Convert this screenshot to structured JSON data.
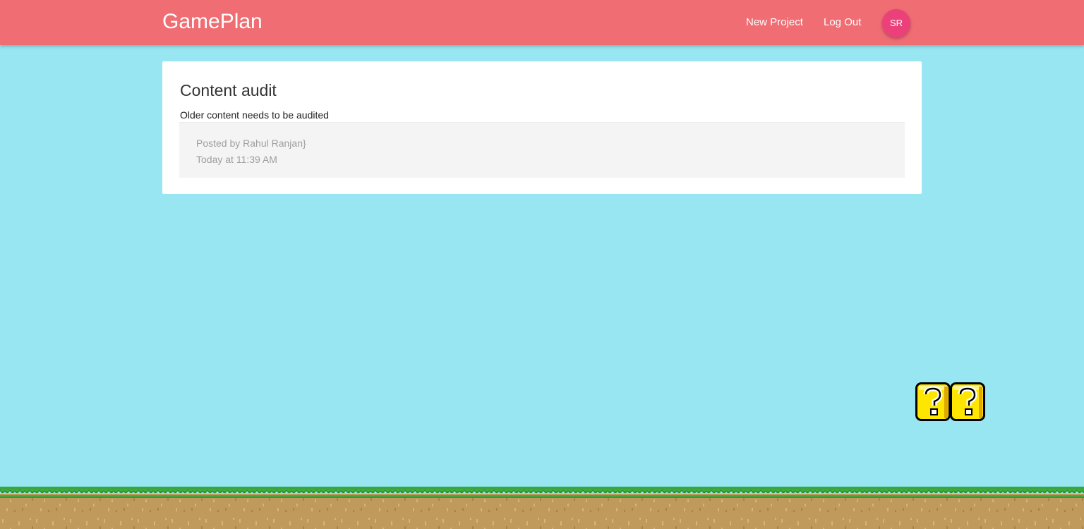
{
  "header": {
    "brand": "GamePlan",
    "nav": {
      "new_project": "New Project",
      "log_out": "Log Out"
    },
    "avatar_initials": "SR"
  },
  "card": {
    "title": "Content audit",
    "description": "Older content needs to be audited",
    "meta": {
      "author": "Posted by Rahul Ranjan}",
      "time": "Today at 11:39 AM"
    }
  },
  "decor": {
    "question_blocks": [
      "question-block-icon",
      "question-block-icon"
    ],
    "ground": "pixel-grass-ground"
  },
  "colors": {
    "navbar": "#f06d73",
    "background": "#97e6f2",
    "avatar": "#ec407a",
    "grass": "#3aa63a",
    "dirt": "#c09a5c"
  }
}
